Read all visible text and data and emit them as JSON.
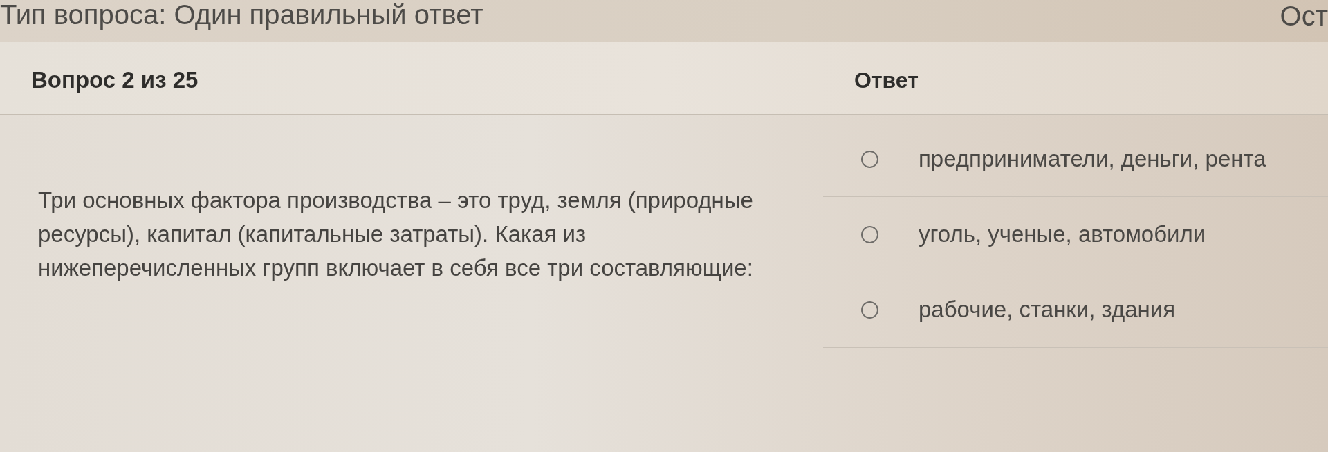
{
  "top_bar": {
    "question_type": "Тип вопроса: Один правильный ответ",
    "right_text": "Ост"
  },
  "header": {
    "question_number": "Вопрос 2 из 25",
    "answer_heading": "Ответ"
  },
  "question": {
    "text": "Три основных фактора производства – это труд, земля (природные ресурсы), капитал (капитальные затраты). Какая из нижеперечисленных групп включает в себя все три составляющие:"
  },
  "options": [
    {
      "label": "предприниматели, деньги, рента",
      "selected": false
    },
    {
      "label": "уголь, ученые, автомобили",
      "selected": false
    },
    {
      "label": "рабочие, станки, здания",
      "selected": false
    }
  ]
}
